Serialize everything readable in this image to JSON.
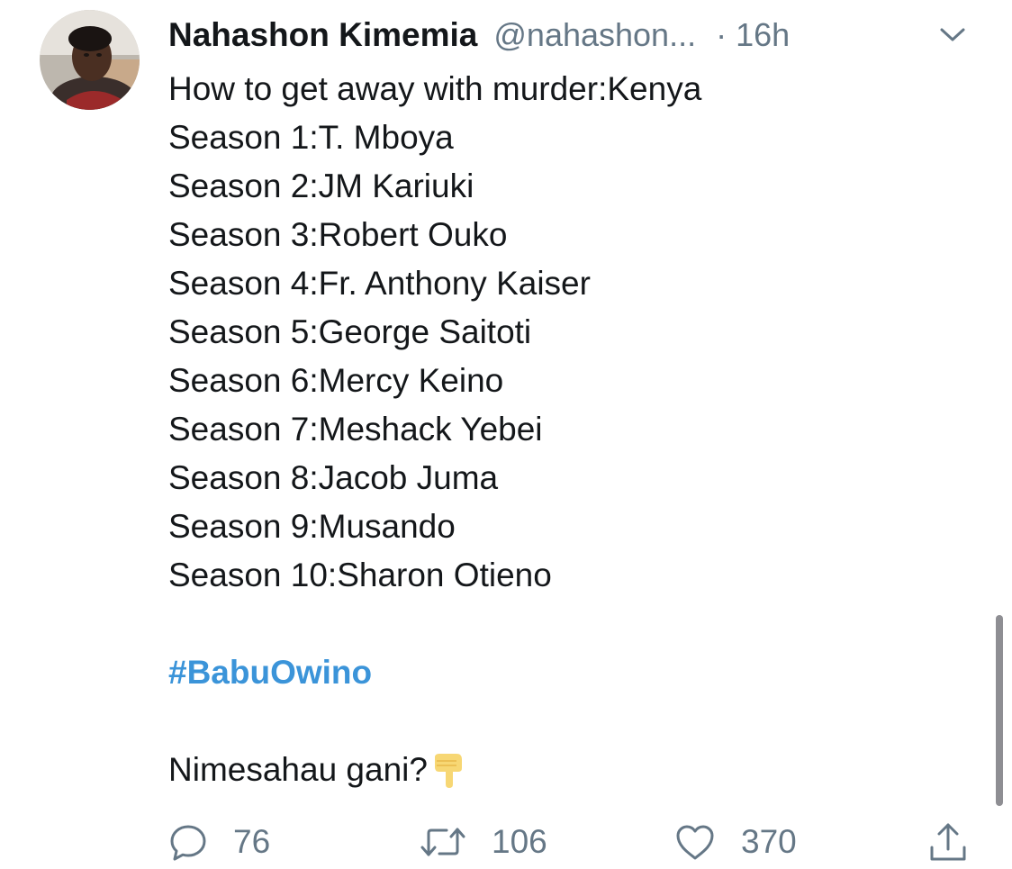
{
  "tweet": {
    "author": {
      "name": "Nahashon Kimemia",
      "handle": "@nahashon...",
      "time": "· 16h"
    },
    "text_lines": [
      "How to get away with murder:Kenya",
      "Season 1:T. Mboya",
      "Season 2:JM Kariuki",
      "Season 3:Robert Ouko",
      "Season 4:Fr. Anthony Kaiser",
      "Season 5:George Saitoti",
      "Season 6:Mercy Keino",
      "Season 7:Meshack Yebei",
      "Season 8:Jacob Juma",
      "Season 9:Musando",
      "Season 10:Sharon Otieno"
    ],
    "hashtag": "#BabuOwino",
    "closing_text": "Nimesahau gani?",
    "closing_emoji": "backhand-index-pointing-down",
    "actions": {
      "replies": "76",
      "retweets": "106",
      "likes": "370"
    }
  },
  "icons": {
    "reply": "reply-icon",
    "retweet": "retweet-icon",
    "like": "heart-icon",
    "share": "share-icon",
    "menu": "chevron-down-icon"
  },
  "colors": {
    "text": "#14171a",
    "secondary": "#657786",
    "link": "#3b94d9",
    "background": "#ffffff"
  }
}
